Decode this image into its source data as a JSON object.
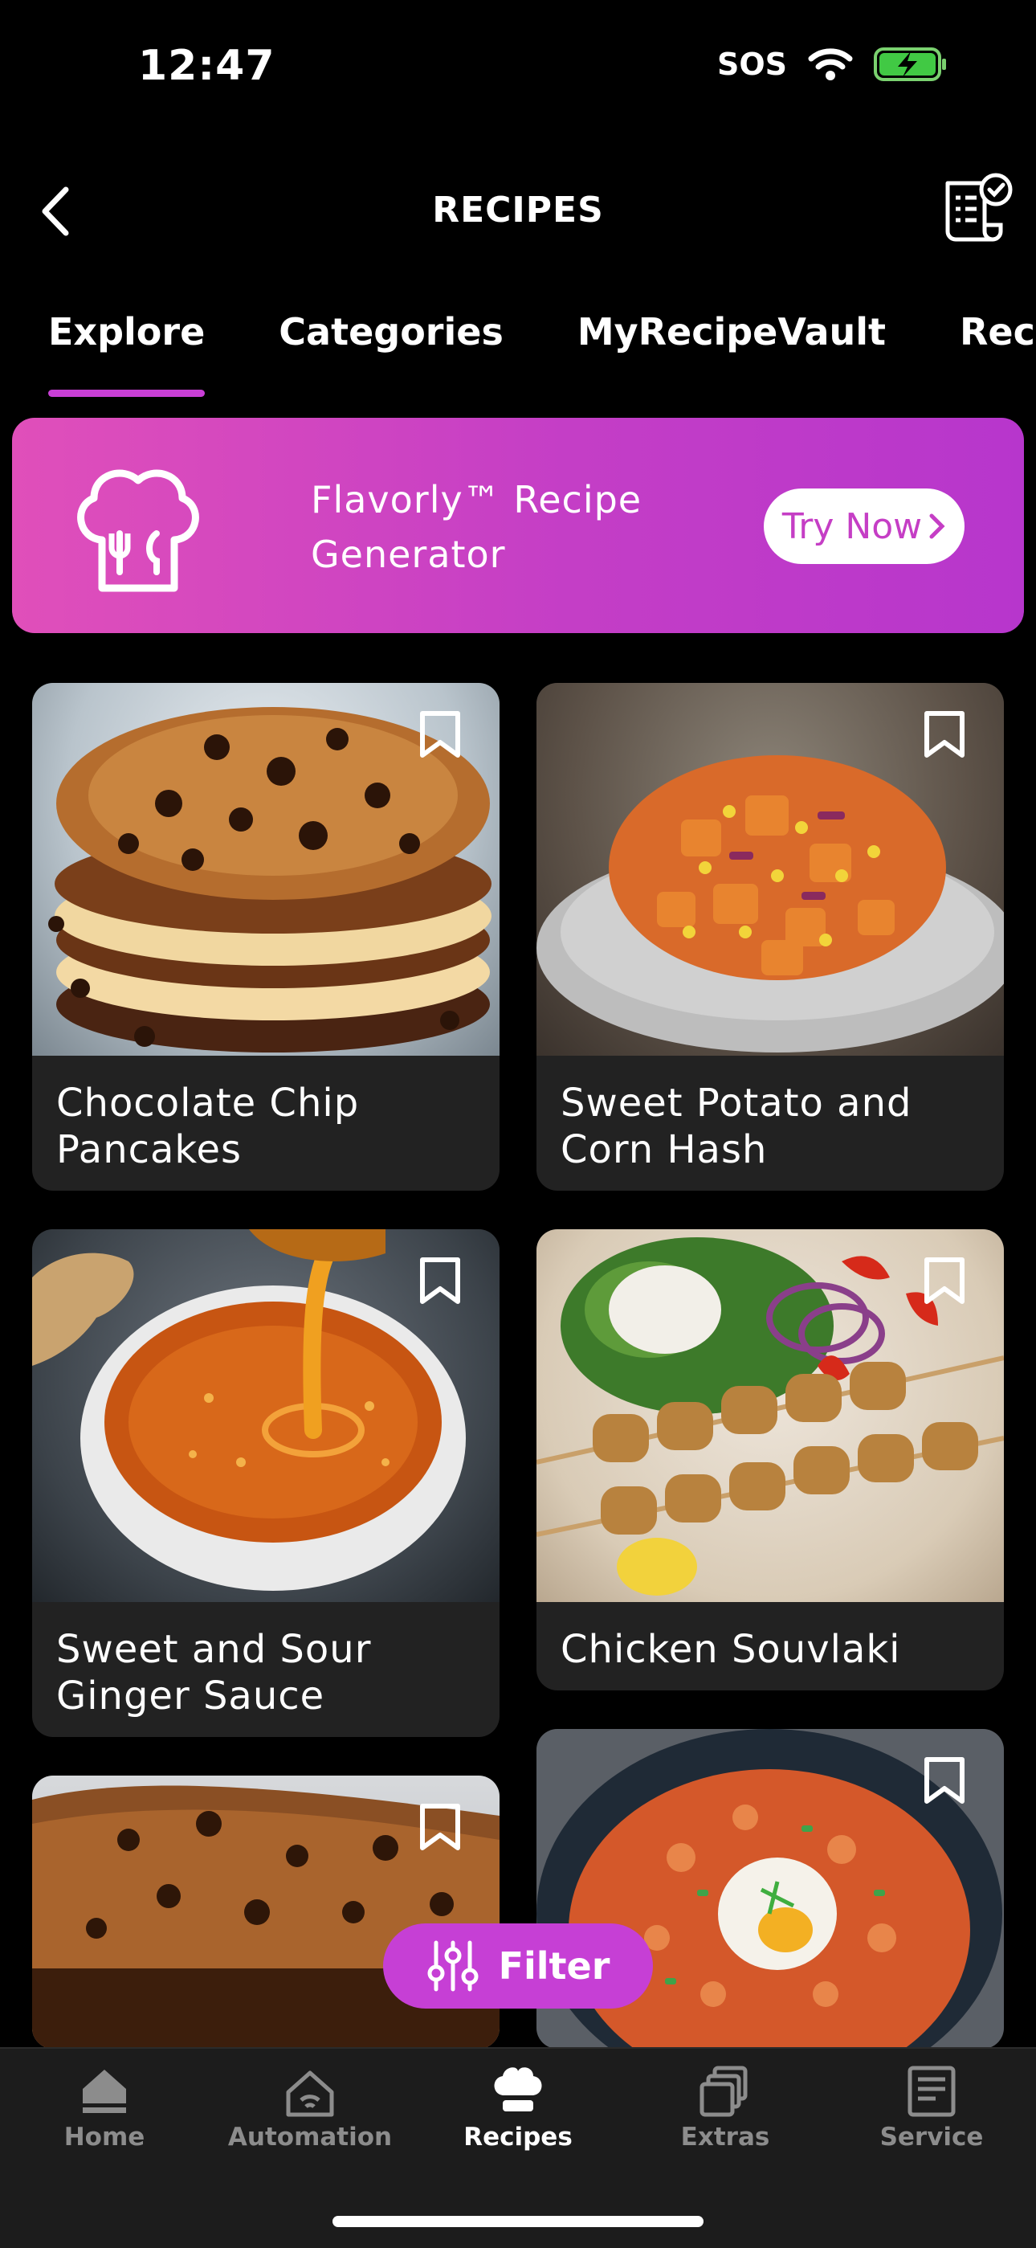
{
  "status": {
    "time": "12:47",
    "carrier": "SOS"
  },
  "header": {
    "title": "RECIPES"
  },
  "tabs": [
    {
      "label": "Explore",
      "active": true
    },
    {
      "label": "Categories"
    },
    {
      "label": "MyRecipeVault"
    },
    {
      "label": "Recer"
    }
  ],
  "banner": {
    "title": "Flavorly™ Recipe Generator",
    "button": "Try Now"
  },
  "recipes": [
    {
      "name": "Chocolate Chip Pancakes"
    },
    {
      "name": "Sweet Potato and Corn Hash"
    },
    {
      "name": "Sweet and Sour Ginger Sauce"
    },
    {
      "name": "Chicken Souvlaki"
    }
  ],
  "filter": {
    "label": "Filter"
  },
  "nav": [
    {
      "label": "Home",
      "icon": "home-icon"
    },
    {
      "label": "Automation",
      "icon": "automation-icon"
    },
    {
      "label": "Recipes",
      "icon": "chef-hat-icon",
      "active": true
    },
    {
      "label": "Extras",
      "icon": "extras-icon"
    },
    {
      "label": "Service",
      "icon": "service-icon"
    }
  ],
  "colors": {
    "accent": "#c93fd6",
    "banner_start": "#e04fba",
    "banner_end": "#b736cc",
    "card_bg": "#222222",
    "nav_bg": "#1c1c1c"
  }
}
